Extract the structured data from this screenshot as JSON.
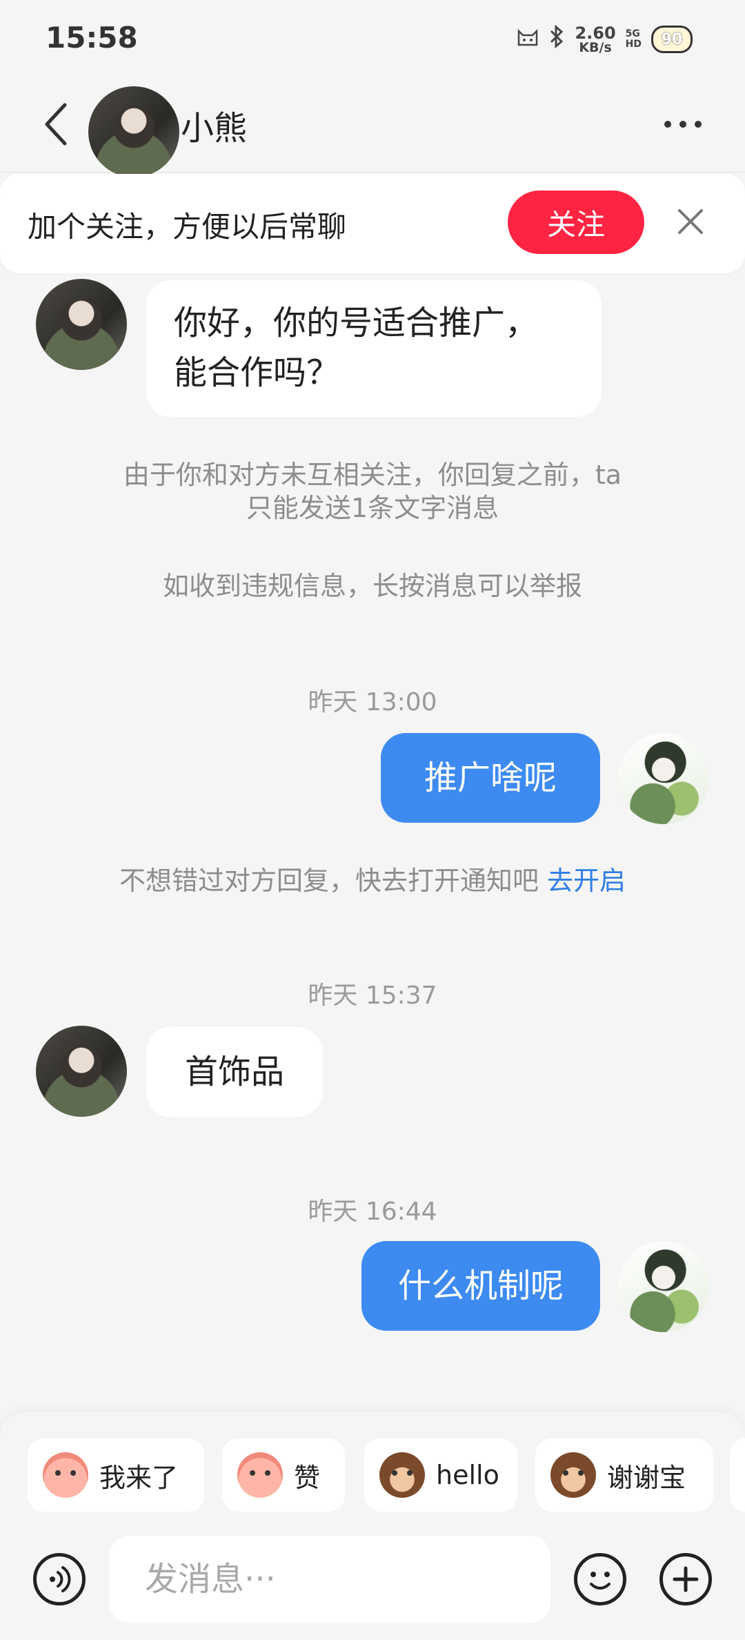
{
  "status_bar": {
    "time": "15:58",
    "net_speed_value": "2.60",
    "net_speed_unit": "KB/s",
    "signal_top": "5G",
    "signal_hd": "HD",
    "battery": "90",
    "icons": [
      "cat-icon",
      "bluetooth-icon",
      "signal-icon",
      "battery-icon"
    ]
  },
  "header": {
    "contact_name": "小熊"
  },
  "follow_banner": {
    "text": "加个关注，方便以后常聊",
    "button_label": "关注"
  },
  "messages": {
    "m1_line1": "你好，你的号适合推广，",
    "m1_line2": "能合作吗？",
    "notice1_line1": "由于你和对方未互相关注，你回复之前，ta",
    "notice1_line2": "只能发送1条文字消息",
    "notice2": "如收到违规信息，长按消息可以举报",
    "time1": "昨天 13:00",
    "m2": "推广啥呢",
    "notify_text": "不想错过对方回复，快去打开通知吧",
    "notify_link": "去开启",
    "time2": "昨天 15:37",
    "m3": "首饰品",
    "time3": "昨天 16:44",
    "m4": "什么机制呢"
  },
  "quick_replies": [
    {
      "label": "我来了",
      "icon": "cartoon-face-icon"
    },
    {
      "label": "赞",
      "icon": "cartoon-face-icon"
    },
    {
      "label": "hello",
      "icon": "monkey-face-icon"
    },
    {
      "label": "谢谢宝",
      "icon": "monkey-rose-icon"
    }
  ],
  "input": {
    "placeholder": "发消息···"
  },
  "colors": {
    "accent_red": "#ff2442",
    "bubble_blue": "#3d8bf1",
    "link_blue": "#2f7ee6",
    "background": "#f5f5f5"
  }
}
